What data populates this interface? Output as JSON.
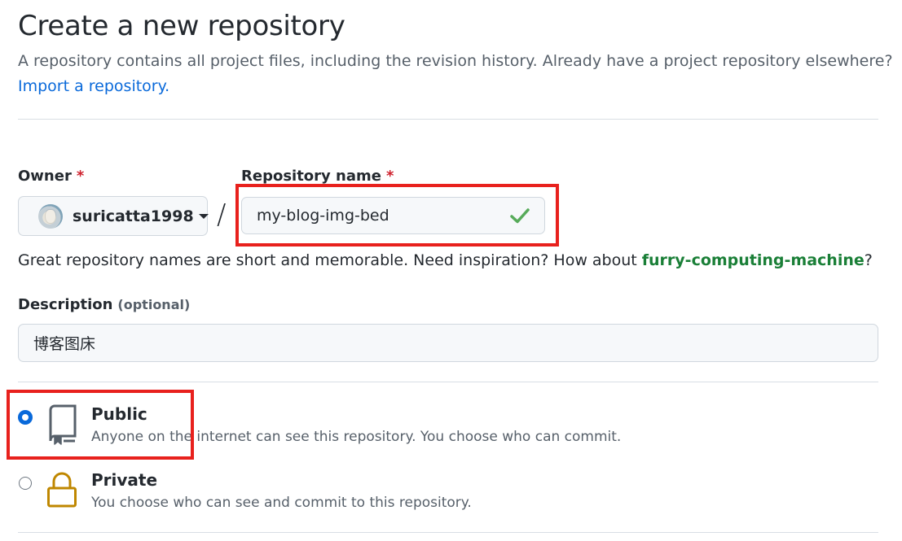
{
  "header": {
    "title": "Create a new repository",
    "subtitle": "A repository contains all project files, including the revision history. Already have a project repository elsewhere?",
    "import_link": "Import a repository."
  },
  "owner": {
    "label": "Owner",
    "required_mark": "*",
    "name": "suricatta1998",
    "icons": {
      "avatar": "avatar-icon",
      "dropdown": "chevron-down-icon"
    }
  },
  "separator": "/",
  "repository": {
    "label": "Repository name",
    "required_mark": "*",
    "value": "my-blog-img-bed",
    "status_icon": "check-icon",
    "status_color": "#57ab5a"
  },
  "hint": {
    "text_before": "Great repository names are short and memorable. Need inspiration? How about ",
    "suggestion": "furry-computing-machine",
    "text_after": "?"
  },
  "description": {
    "label": "Description",
    "optional_label": "(optional)",
    "value": "博客图床"
  },
  "visibility": {
    "public": {
      "title": "Public",
      "description": "Anyone on the internet can see this repository. You choose who can commit.",
      "selected": true,
      "icon": "repo-icon"
    },
    "private": {
      "title": "Private",
      "description": "You choose who can see and commit to this repository.",
      "selected": false,
      "icon": "lock-icon",
      "icon_color": "#bf8700"
    }
  },
  "colors": {
    "accent": "#0969da",
    "success": "#1a7f37",
    "required": "#cf222e",
    "annotation_box": "#e8211d"
  }
}
